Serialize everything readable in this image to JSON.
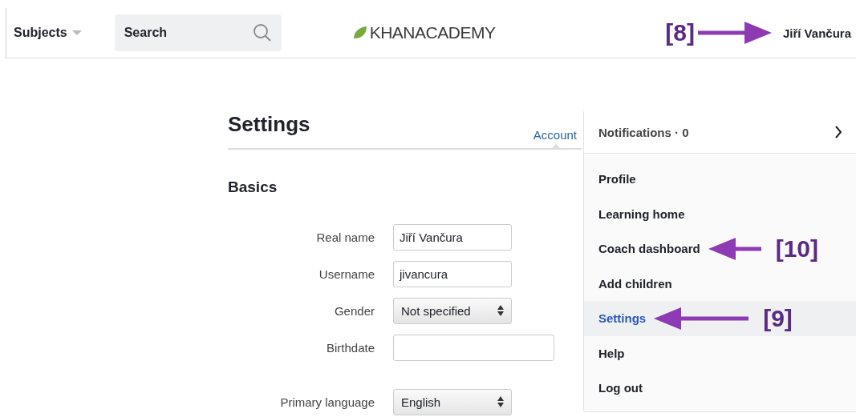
{
  "header": {
    "subjects": "Subjects",
    "search": {
      "placeholder": "Search"
    },
    "logo": "**KHAN**ACADEMY",
    "user": {
      "name": "Jiří Vančura",
      "callout": "[8]"
    }
  },
  "settings": {
    "title": "Settings",
    "tabs": [
      {
        "label": "Account",
        "selected": true
      }
    ],
    "section": "Basics",
    "fields": [
      {
        "kind": "text",
        "label": "Real name",
        "value": "Jiří Vančura"
      },
      {
        "kind": "text",
        "label": "Username",
        "value": "jivancura"
      },
      {
        "kind": "select",
        "label": "Gender",
        "value": "Not specified"
      },
      {
        "kind": "wide",
        "label": "Birthdate"
      },
      {
        "kind": "select",
        "label": "Primary language",
        "value": "English",
        "spaced": true
      }
    ]
  },
  "menu": {
    "notifications": {
      "label": "Notifications",
      "separator": "·",
      "count": "0"
    },
    "items": [
      {
        "label": "Profile",
        "selected": false
      },
      {
        "label": "Learning home",
        "selected": false
      },
      {
        "label": "Coach dashboard",
        "selected": false,
        "callout": "[10]"
      },
      {
        "label": "Add children",
        "selected": false
      },
      {
        "label": "Settings",
        "selected": true,
        "callout": "[9]"
      },
      {
        "label": "Help",
        "selected": false
      },
      {
        "label": "Log out",
        "selected": false
      }
    ]
  }
}
